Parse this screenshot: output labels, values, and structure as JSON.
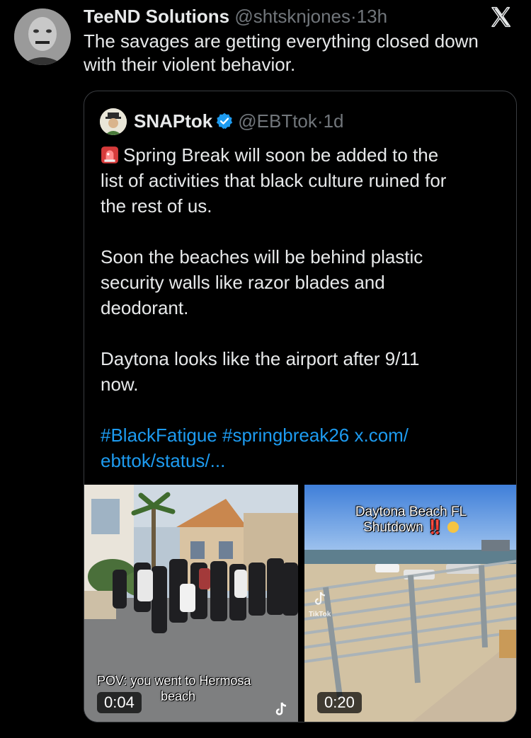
{
  "tweet": {
    "author_name": "TeeND Solutions",
    "handle": "@shtsknjones",
    "separator": "·",
    "time": "13h",
    "text_line1": "The savages are getting everything closed down",
    "text_line2": "with their violent behavior."
  },
  "quoted": {
    "author_name": "SNAPtok",
    "handle": "@EBTtok",
    "separator": "·",
    "time": "1d",
    "p1_line1": "Spring Break will soon be added to the",
    "p1_line2": "list of activities that black culture ruined for",
    "p1_line3": "the rest of us.",
    "p2_line1": "Soon the beaches will be behind plastic",
    "p2_line2": "security walls like razor blades and",
    "p2_line3": "deodorant.",
    "p3_line1": "Daytona looks like the airport after 9/11",
    "p3_line2": "now.",
    "hashtag1": "#BlackFatigue",
    "hashtag2": "#springbreak26",
    "link_part1": "x.com/",
    "link_part2": "ebttok/status/..."
  },
  "media": {
    "left": {
      "caption_line1": "POV: you went to Hermosa",
      "caption_line2": "beach",
      "duration": "0:04"
    },
    "right": {
      "caption_line1": "Daytona Beach FL",
      "caption_line2": "Shutdown",
      "caption_emoji": "‼️",
      "watermark": "TikTok",
      "duration": "0:20"
    }
  },
  "icons": {
    "x_logo": "x-logo-icon",
    "verified": "verified-badge-icon",
    "siren": "police-light-icon",
    "tiktok": "tiktok-icon"
  },
  "colors": {
    "background": "#000000",
    "text": "#e7e9ea",
    "secondary": "#71767b",
    "link": "#1d9bf0",
    "border": "#3a3d41"
  }
}
